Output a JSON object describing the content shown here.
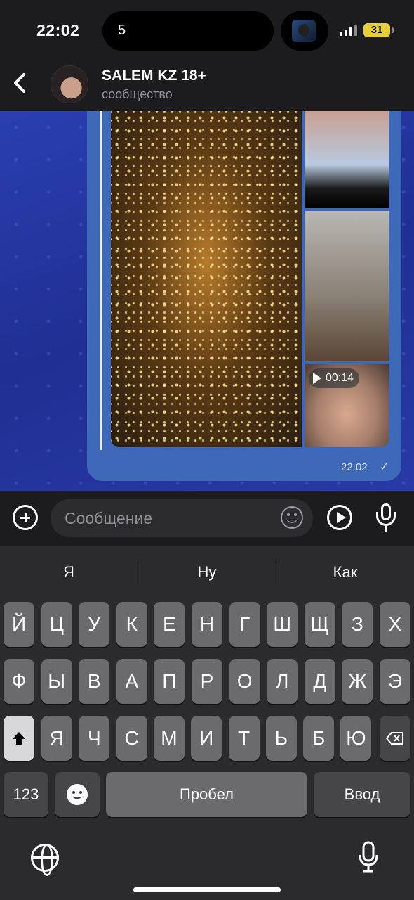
{
  "status_bar": {
    "time": "22:02",
    "island_text": "5",
    "battery": "31"
  },
  "header": {
    "back_icon": "chevron-left-icon",
    "title": "SALEM KZ 18+",
    "subtitle": "сообщество"
  },
  "message": {
    "video_duration": "00:14",
    "time": "22:02",
    "status_icon": "checkmark-icon"
  },
  "composer": {
    "placeholder": "Сообщение"
  },
  "keyboard": {
    "suggestions": [
      "Я",
      "Ну",
      "Как"
    ],
    "row1": [
      "Й",
      "Ц",
      "У",
      "К",
      "Е",
      "Н",
      "Г",
      "Ш",
      "Щ",
      "З",
      "Х"
    ],
    "row2": [
      "Ф",
      "Ы",
      "В",
      "А",
      "П",
      "Р",
      "О",
      "Л",
      "Д",
      "Ж",
      "Э"
    ],
    "row3": [
      "Я",
      "Ч",
      "С",
      "М",
      "И",
      "Т",
      "Ь",
      "Б",
      "Ю"
    ],
    "numbers_label": "123",
    "space_label": "Пробел",
    "return_label": "Ввод"
  },
  "colors": {
    "chat_bg": "#2535a8",
    "bubble": "#3d69b8",
    "battery": "#e7cf3a"
  }
}
